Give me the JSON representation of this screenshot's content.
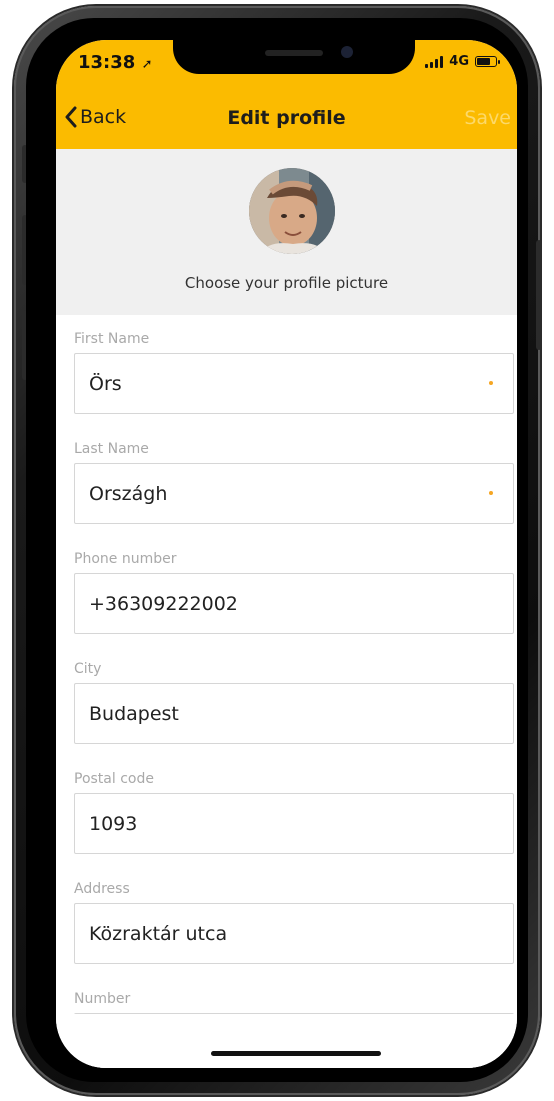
{
  "status": {
    "time": "13:38",
    "network": "4G"
  },
  "nav": {
    "back_label": "Back",
    "title": "Edit profile",
    "save_label": "Save"
  },
  "profile": {
    "caption": "Choose your profile picture"
  },
  "form": {
    "fields": [
      {
        "label": "First Name",
        "value": "Örs",
        "required": true
      },
      {
        "label": "Last Name",
        "value": "Országh",
        "required": true
      },
      {
        "label": "Phone number",
        "value": "+36309222002",
        "required": false
      },
      {
        "label": "City",
        "value": "Budapest",
        "required": false
      },
      {
        "label": "Postal code",
        "value": "1093",
        "required": false
      },
      {
        "label": "Address",
        "value": "Közraktár utca",
        "required": false
      },
      {
        "label": "Number",
        "value": "",
        "required": false
      }
    ]
  },
  "colors": {
    "header": "#fbbb00",
    "required_dot": "#f5a623",
    "save_disabled": "#fcd96a"
  }
}
